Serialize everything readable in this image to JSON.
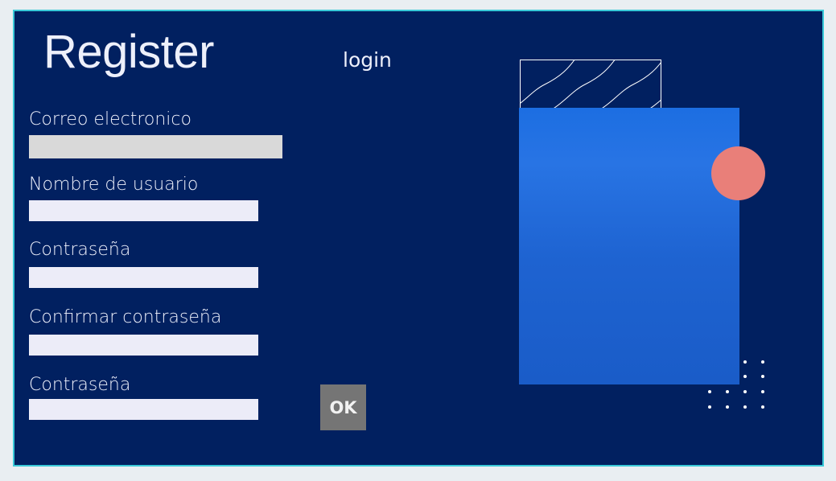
{
  "header": {
    "title": "Register",
    "login_link": "login"
  },
  "form": {
    "fields": [
      {
        "label": "Correo electronico",
        "value": ""
      },
      {
        "label": "Nombre de usuario",
        "value": ""
      },
      {
        "label": "Contraseña",
        "value": ""
      },
      {
        "label": "Confirmar contraseña",
        "value": ""
      },
      {
        "label": "Contraseña",
        "value": ""
      }
    ],
    "submit_label": "OK"
  },
  "colors": {
    "background": "#012060",
    "frame_border": "#39c9d8",
    "panel_blue": "#1c6ee2",
    "accent_circle": "#e97f79",
    "button": "#757575"
  }
}
